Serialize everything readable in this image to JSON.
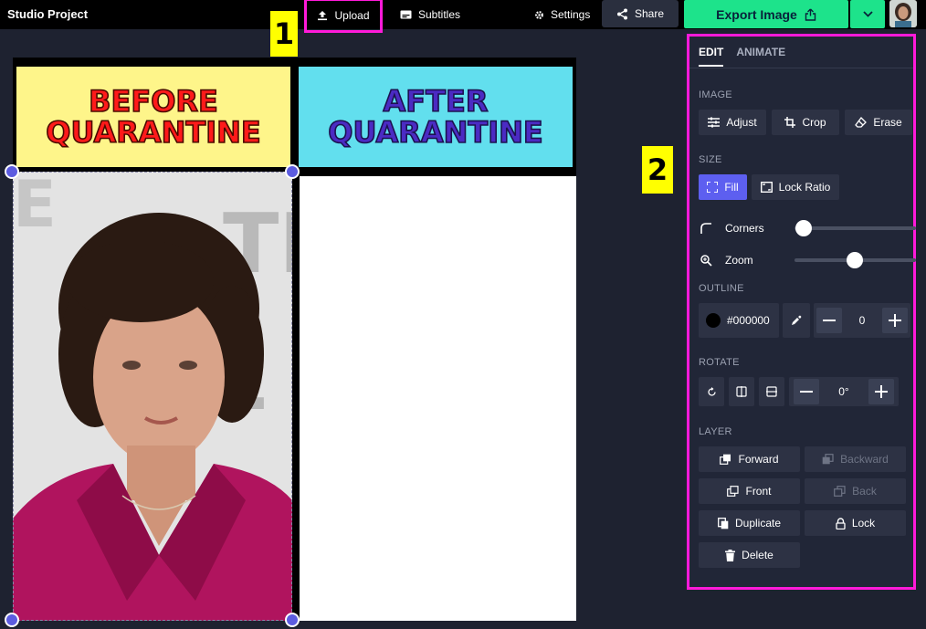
{
  "topbar": {
    "project_title": "Studio Project",
    "upload_label": "Upload",
    "subtitles_label": "Subtitles",
    "settings_label": "Settings",
    "share_label": "Share",
    "export_label": "Export Image"
  },
  "markers": {
    "one": "1",
    "two": "2"
  },
  "canvas": {
    "before_text": "Before Quarantine",
    "after_text": "After Quarantine"
  },
  "panel": {
    "tabs": [
      "EDIT",
      "ANIMATE"
    ],
    "image_section": "IMAGE",
    "adjust_label": "Adjust",
    "crop_label": "Crop",
    "erase_label": "Erase",
    "size_section": "SIZE",
    "fill_label": "Fill",
    "lock_ratio_label": "Lock Ratio",
    "corners_label": "Corners",
    "zoom_label": "Zoom",
    "outline_section": "OUTLINE",
    "outline_color": "#000000",
    "outline_width": "0",
    "rotate_section": "ROTATE",
    "rotate_value": "0°",
    "layer_section": "LAYER",
    "forward_label": "Forward",
    "backward_label": "Backward",
    "front_label": "Front",
    "back_label": "Back",
    "duplicate_label": "Duplicate",
    "lock_label": "Lock",
    "delete_label": "Delete"
  },
  "colors": {
    "highlight": "#ff1ad9",
    "export": "#1de38b",
    "accent": "#5d5ff0",
    "marker": "#ffff00"
  }
}
